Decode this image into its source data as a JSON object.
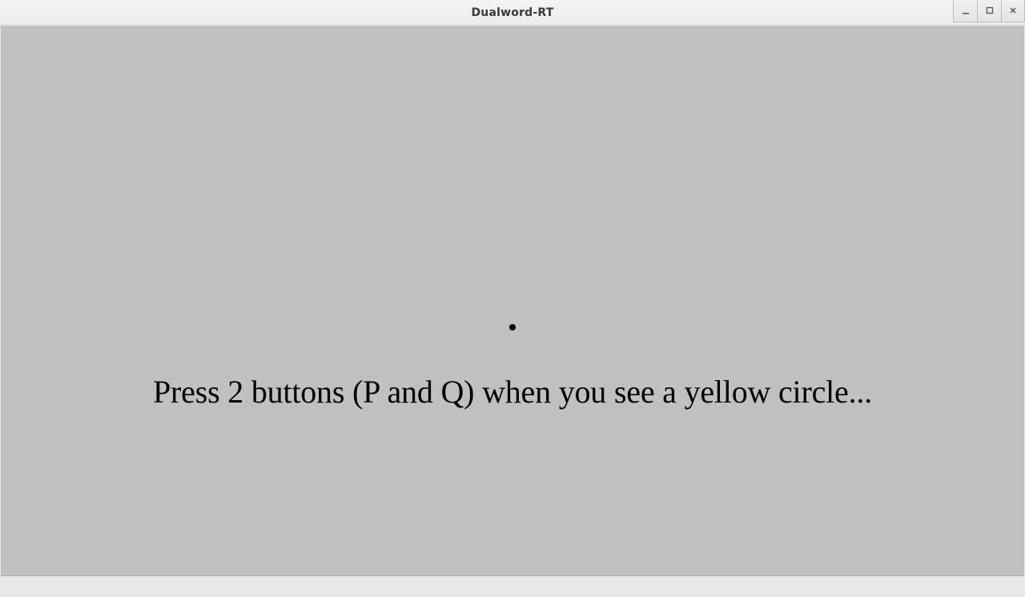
{
  "window": {
    "title": "Dualword-RT"
  },
  "main": {
    "instruction": "Press 2 buttons (P and Q) when you see a yellow circle..."
  }
}
